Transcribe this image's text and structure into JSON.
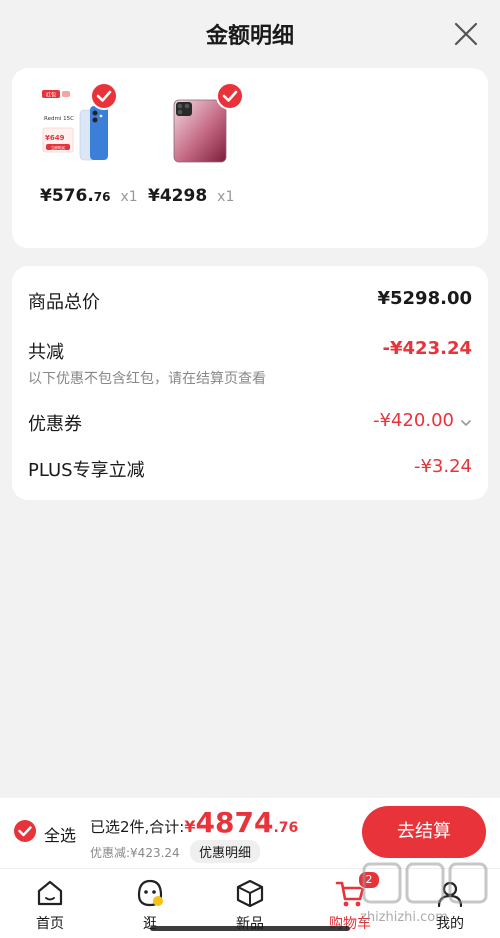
{
  "header": {
    "title": "金额明细"
  },
  "products": [
    {
      "yuan": "¥",
      "price_int": "576.",
      "price_dec": "76",
      "qty": "x1"
    },
    {
      "yuan": "¥",
      "price_int": "4298",
      "price_dec": "",
      "qty": "x1"
    }
  ],
  "product1_promo": {
    "tag": "红包",
    "name": "Redmi 15C",
    "price": "¥649",
    "button": "立即购买"
  },
  "summary": {
    "total_label": "商品总价",
    "total_value": "¥5298.00",
    "reduce_label": "共减",
    "reduce_value": "-¥423.24",
    "reduce_note": "以下优惠不包含红包，请在结算页查看",
    "coupon_label": "优惠券",
    "coupon_value": "-¥420.00",
    "plus_label": "PLUS专享立减",
    "plus_value": "-¥3.24"
  },
  "checkout": {
    "select_all": "全选",
    "selected_text": "已选2件,合计:",
    "yuan": "¥",
    "total_int": "4874",
    "total_dec": ".76",
    "discount_text": "优惠减:¥423.24",
    "detail_btn": "优惠明细",
    "checkout_btn": "去结算"
  },
  "tabs": [
    {
      "label": "首页"
    },
    {
      "label": "逛"
    },
    {
      "label": "新品"
    },
    {
      "label": "购物车",
      "badge": "2"
    },
    {
      "label": "我的"
    }
  ],
  "watermark": "zhizhizhi.com",
  "colors": {
    "accent": "#e8333a",
    "background": "#f2f2f2",
    "muted": "#888888"
  }
}
